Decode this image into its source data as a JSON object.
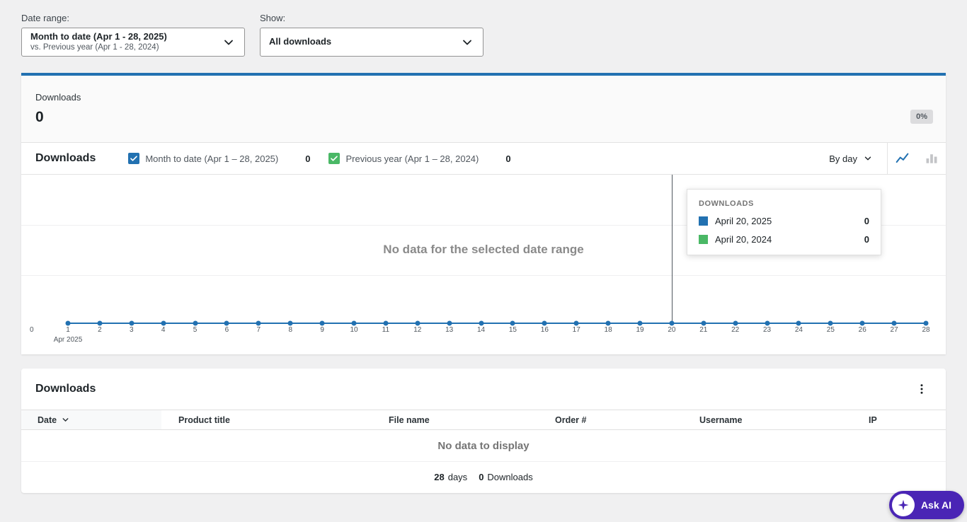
{
  "colors": {
    "accent_blue": "#2271b1",
    "series_green": "#4ab866",
    "ask_ai_purple": "#4a25b5"
  },
  "filters": {
    "date_range_label": "Date range:",
    "date_range_primary": "Month to date (Apr 1 - 28, 2025)",
    "date_range_secondary": "vs. Previous year (Apr 1 - 28, 2024)",
    "show_label": "Show:",
    "show_value": "All downloads"
  },
  "summary": {
    "label": "Downloads",
    "value": "0",
    "delta": "0%"
  },
  "chart": {
    "title": "Downloads",
    "interval_label": "By day",
    "empty_message": "No data for the selected date range",
    "hover_index": 19,
    "series": [
      {
        "label": "Month to date (Apr 1 – 28, 2025)",
        "value": "0",
        "color": "#2271b1"
      },
      {
        "label": "Previous year (Apr 1 – 28, 2024)",
        "value": "0",
        "color": "#4ab866"
      }
    ],
    "tooltip": {
      "heading": "DOWNLOADS",
      "rows": [
        {
          "label": "April 20, 2025",
          "value": "0",
          "color": "#2271b1"
        },
        {
          "label": "April 20, 2024",
          "value": "0",
          "color": "#4ab866"
        }
      ]
    },
    "y_zero_label": "0",
    "x_month_label": "Apr 2025"
  },
  "chart_data": {
    "type": "line",
    "title": "Downloads",
    "x": [
      1,
      2,
      3,
      4,
      5,
      6,
      7,
      8,
      9,
      10,
      11,
      12,
      13,
      14,
      15,
      16,
      17,
      18,
      19,
      20,
      21,
      22,
      23,
      24,
      25,
      26,
      27,
      28
    ],
    "series": [
      {
        "name": "Month to date (Apr 1 – 28, 2025)",
        "values": [
          0,
          0,
          0,
          0,
          0,
          0,
          0,
          0,
          0,
          0,
          0,
          0,
          0,
          0,
          0,
          0,
          0,
          0,
          0,
          0,
          0,
          0,
          0,
          0,
          0,
          0,
          0,
          0
        ]
      },
      {
        "name": "Previous year (Apr 1 – 28, 2024)",
        "values": [
          0,
          0,
          0,
          0,
          0,
          0,
          0,
          0,
          0,
          0,
          0,
          0,
          0,
          0,
          0,
          0,
          0,
          0,
          0,
          0,
          0,
          0,
          0,
          0,
          0,
          0,
          0,
          0
        ]
      }
    ],
    "xlabel": "Apr 2025",
    "ylabel": "",
    "ylim": [
      0,
      1
    ],
    "grid": true,
    "legend_position": "top"
  },
  "table": {
    "title": "Downloads",
    "columns": [
      {
        "label": "Date",
        "sorted": true
      },
      {
        "label": "Product title"
      },
      {
        "label": "File name"
      },
      {
        "label": "Order #"
      },
      {
        "label": "Username"
      },
      {
        "label": "IP"
      }
    ],
    "empty_message": "No data to display",
    "footer": {
      "days_count": "28",
      "days_unit": "days",
      "downloads_count": "0",
      "downloads_unit": "Downloads"
    }
  },
  "ask_ai": {
    "label": "Ask AI"
  }
}
